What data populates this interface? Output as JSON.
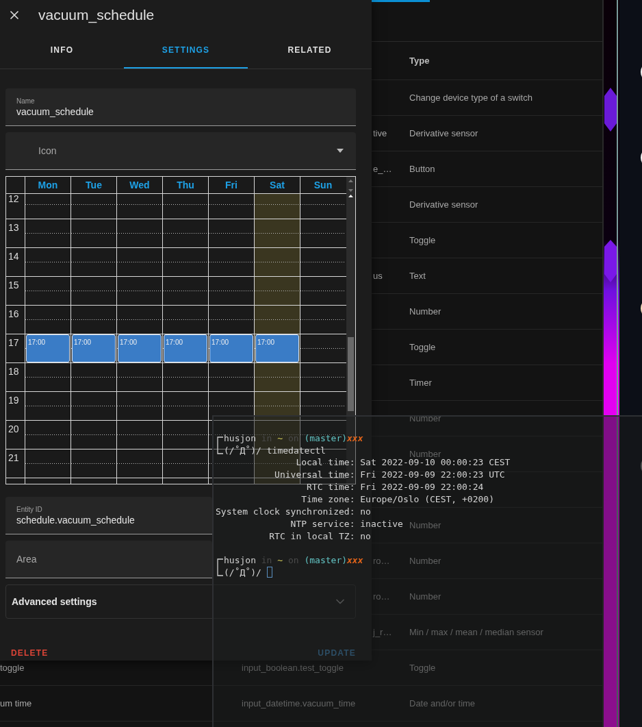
{
  "app_table": {
    "header": {
      "type": "Type"
    },
    "rows": [
      {
        "kind": "plain",
        "type": "Change device type of a switch"
      },
      {
        "kind": "cut",
        "entity": "tive",
        "type": "Derivative sensor"
      },
      {
        "kind": "cut",
        "entity": "e_…",
        "type": "Button"
      },
      {
        "kind": "plain",
        "type": "Derivative sensor"
      },
      {
        "kind": "plain",
        "type": "Toggle"
      },
      {
        "kind": "cut",
        "entity": "us",
        "type": "Text"
      },
      {
        "kind": "plain",
        "type": "Number"
      },
      {
        "kind": "plain",
        "type": "Toggle"
      },
      {
        "kind": "plain",
        "type": "Timer"
      },
      {
        "kind": "plain",
        "type": "Number"
      },
      {
        "kind": "plain",
        "type": "Number"
      },
      {
        "kind": "plain"
      },
      {
        "kind": "plain",
        "type": "Number"
      },
      {
        "kind": "cut",
        "entity": "ro…",
        "type": "Number"
      },
      {
        "kind": "cut",
        "entity": "ro…",
        "type": "Number"
      },
      {
        "kind": "cut",
        "entity": "j_r…",
        "type": "Min / max / mean / median sensor"
      },
      {
        "kind": "full",
        "name": "toggle",
        "entity": "input_boolean.test_toggle",
        "type": "Toggle"
      },
      {
        "kind": "full",
        "name": "um time",
        "entity": "input_datetime.vacuum_time",
        "type": "Date and/or time"
      }
    ]
  },
  "dialog": {
    "title": "vacuum_schedule",
    "tabs": [
      {
        "label": "INFO",
        "selected": false
      },
      {
        "label": "SETTINGS",
        "selected": true
      },
      {
        "label": "RELATED",
        "selected": false
      }
    ],
    "name_field": {
      "label": "Name",
      "value": "vacuum_schedule"
    },
    "icon_field": {
      "placeholder": "Icon"
    },
    "schedule": {
      "days": [
        {
          "label": "Mon",
          "today": false
        },
        {
          "label": "Tue",
          "today": false
        },
        {
          "label": "Wed",
          "today": false
        },
        {
          "label": "Thu",
          "today": false
        },
        {
          "label": "Fri",
          "today": false
        },
        {
          "label": "Sat",
          "today": true
        },
        {
          "label": "Sun",
          "today": false
        }
      ],
      "hours": [
        {
          "label": "12"
        },
        {
          "label": "13"
        },
        {
          "label": "14"
        },
        {
          "label": "15"
        },
        {
          "label": "16"
        },
        {
          "label": "17",
          "slots": [
            {
              "event": "17:00"
            },
            {
              "event": "17:00"
            },
            {
              "event": "17:00"
            },
            {
              "event": "17:00"
            },
            {
              "event": "17:00"
            },
            {
              "event": "17:00"
            }
          ]
        },
        {
          "label": "18"
        },
        {
          "label": "19"
        },
        {
          "label": "20"
        },
        {
          "label": "21"
        }
      ]
    },
    "entity_id_field": {
      "label": "Entity ID",
      "value": "schedule.vacuum_schedule"
    },
    "area_field": {
      "placeholder": "Area"
    },
    "advanced": {
      "label": "Advanced settings",
      "expanded": false
    },
    "buttons": [
      {
        "label": "DELETE",
        "kind": "danger",
        "disabled": false
      },
      {
        "label": "UPDATE",
        "kind": "primary",
        "disabled": true
      }
    ]
  },
  "terminal": {
    "blocks": [
      {
        "kind": "prompt",
        "user": "husjon",
        "in": "in",
        "path": "~",
        "on": "on",
        "branch": "(master)",
        "status": "xxx",
        "symbol": "(/˚Д˚)/",
        "command": "timedatectl",
        "cursor": false
      },
      {
        "kind": "output",
        "lines": [
          {
            "label": "Local time:",
            "value": "Sat 2022-09-10 00:00:23 CEST"
          },
          {
            "label": "Universal time:",
            "value": "Fri 2022-09-09 22:00:23 UTC"
          },
          {
            "label": "RTC time:",
            "value": "Fri 2022-09-09 22:00:24"
          },
          {
            "label": "Time zone:",
            "value": "Europe/Oslo (CEST, +0200)"
          },
          {
            "label": "System clock synchronized:",
            "value": "no"
          },
          {
            "label": "NTP service:",
            "value": "inactive"
          },
          {
            "label": "RTC in local TZ:",
            "value": "no"
          }
        ]
      },
      {
        "kind": "prompt",
        "user": "husjon",
        "in": "in",
        "path": "~",
        "on": "on",
        "branch": "(master)",
        "status": "xxx",
        "symbol": "(/˚Д˚)/",
        "cursor": true
      }
    ]
  }
}
